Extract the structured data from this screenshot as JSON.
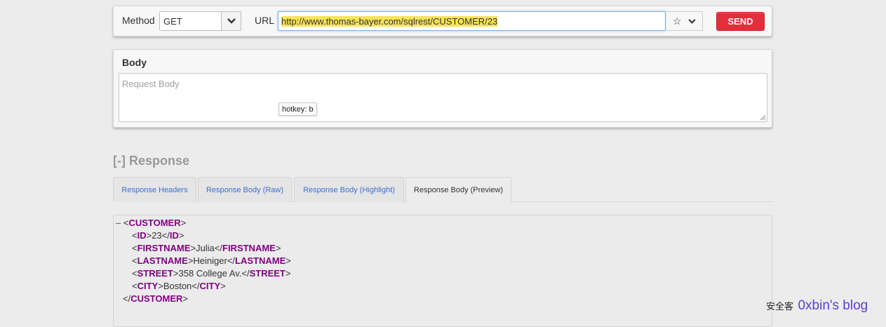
{
  "request": {
    "method_label": "Method",
    "method_value": "GET",
    "url_label": "URL",
    "url_value": "http://www.thomas-bayer.com/sqlrest/CUSTOMER/23",
    "send_label": "SEND"
  },
  "body": {
    "title": "Body",
    "placeholder": "Request Body",
    "hotkey_tooltip": "hotkey: b"
  },
  "response": {
    "heading": "[-] Response",
    "tabs": [
      {
        "label": "Response Headers",
        "active": false
      },
      {
        "label": "Response Body (Raw)",
        "active": false
      },
      {
        "label": "Response Body (Highlight)",
        "active": false
      },
      {
        "label": "Response Body (Preview)",
        "active": true
      }
    ],
    "xml": {
      "collapse": "–",
      "root": "CUSTOMER",
      "children": [
        {
          "tag": "ID",
          "value": "23"
        },
        {
          "tag": "FIRSTNAME",
          "value": "Julia"
        },
        {
          "tag": "LASTNAME",
          "value": "Heiniger"
        },
        {
          "tag": "STREET",
          "value": "358 College Av."
        },
        {
          "tag": "CITY",
          "value": "Boston"
        }
      ]
    }
  },
  "watermark": {
    "cn_text": "安全客",
    "blog_text": "0xbin's blog"
  },
  "colors": {
    "send_button": "#e32f3b",
    "url_highlight": "#f7e35a",
    "xml_tag": "#800080",
    "tab_link": "#3b6fd1"
  },
  "icons": {
    "method_dropdown": "chevron-down-icon",
    "favorite": "star-icon",
    "url_dropdown": "chevron-down-icon"
  }
}
